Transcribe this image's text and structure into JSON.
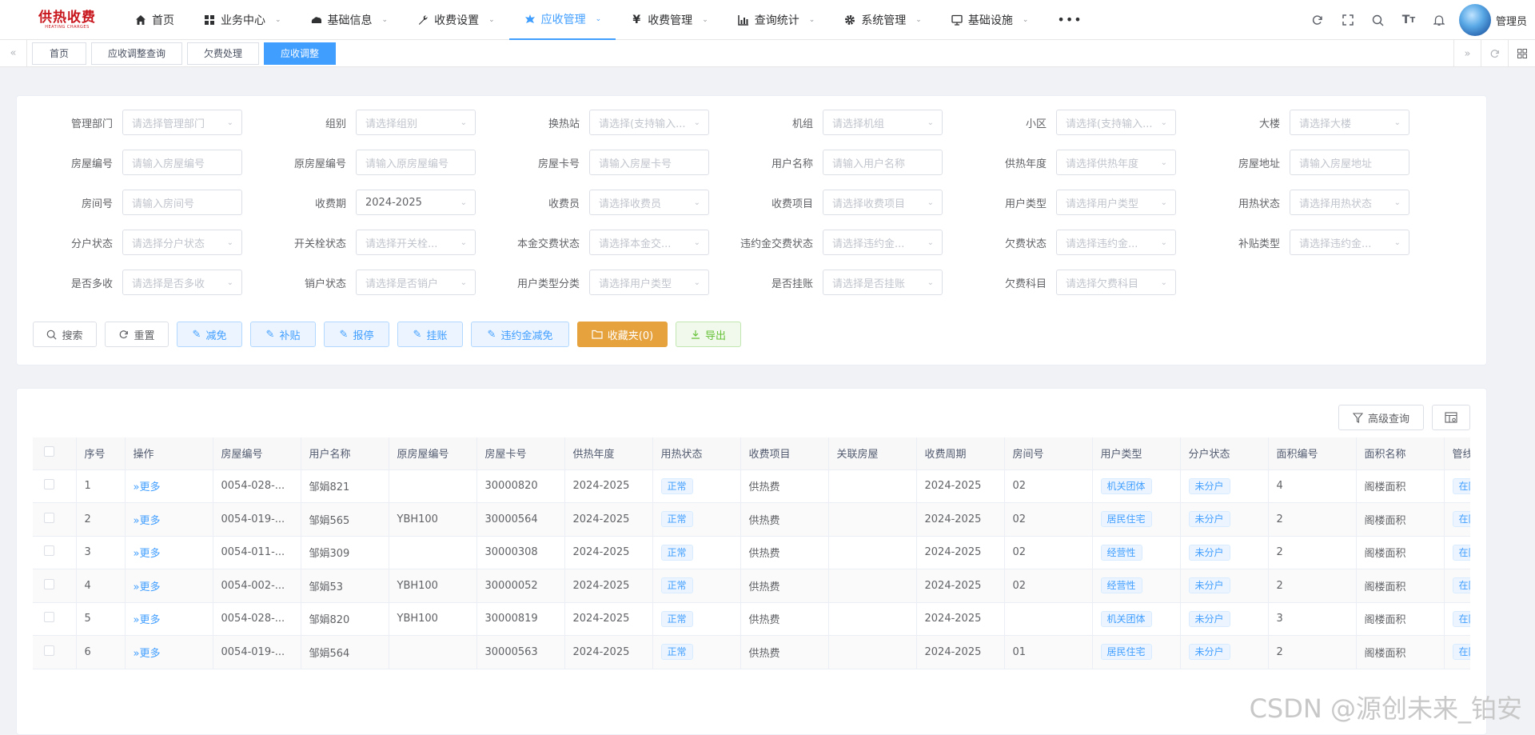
{
  "logo": {
    "main": "供热收费",
    "sub": "HEATING CHARGES"
  },
  "nav": [
    {
      "label": "首页",
      "icon": "home-icon",
      "chevron": false,
      "active": false
    },
    {
      "label": "业务中心",
      "icon": "grid-icon",
      "chevron": true,
      "active": false
    },
    {
      "label": "基础信息",
      "icon": "cloud-icon",
      "chevron": true,
      "active": false
    },
    {
      "label": "收费设置",
      "icon": "wrench-icon",
      "chevron": true,
      "active": false
    },
    {
      "label": "应收管理",
      "icon": "leaf-icon",
      "chevron": true,
      "active": true
    },
    {
      "label": "收费管理",
      "icon": "yen-icon",
      "chevron": true,
      "active": false
    },
    {
      "label": "查询统计",
      "icon": "chart-icon",
      "chevron": true,
      "active": false
    },
    {
      "label": "系统管理",
      "icon": "gear-icon",
      "chevron": true,
      "active": false
    },
    {
      "label": "基础设施",
      "icon": "monitor-icon",
      "chevron": true,
      "active": false
    }
  ],
  "user": {
    "name": "管理员"
  },
  "tabs": [
    {
      "label": "首页",
      "active": false
    },
    {
      "label": "应收调整查询",
      "active": false
    },
    {
      "label": "欠费处理",
      "active": false
    },
    {
      "label": "应收调整",
      "active": true
    }
  ],
  "form": {
    "row1": [
      {
        "label": "管理部门",
        "placeholder": "请选择管理部门"
      },
      {
        "label": "组别",
        "placeholder": "请选择组别"
      },
      {
        "label": "换热站",
        "placeholder": "请选择(支持输入..."
      },
      {
        "label": "机组",
        "placeholder": "请选择机组"
      },
      {
        "label": "小区",
        "placeholder": "请选择(支持输入..."
      },
      {
        "label": "大楼",
        "placeholder": "请选择大楼"
      }
    ],
    "row2": [
      {
        "label": "房屋编号",
        "placeholder": "请输入房屋编号"
      },
      {
        "label": "原房屋编号",
        "placeholder": "请输入原房屋编号"
      },
      {
        "label": "房屋卡号",
        "placeholder": "请输入房屋卡号"
      },
      {
        "label": "用户名称",
        "placeholder": "请输入用户名称"
      },
      {
        "label": "供热年度",
        "placeholder": "请选择供热年度"
      },
      {
        "label": "房屋地址",
        "placeholder": "请输入房屋地址"
      }
    ],
    "row3": [
      {
        "label": "房间号",
        "placeholder": "请输入房间号"
      },
      {
        "label": "收费期",
        "value": "2024-2025"
      },
      {
        "label": "收费员",
        "placeholder": "请选择收费员"
      },
      {
        "label": "收费项目",
        "placeholder": "请选择收费项目"
      },
      {
        "label": "用户类型",
        "placeholder": "请选择用户类型"
      },
      {
        "label": "用热状态",
        "placeholder": "请选择用热状态"
      }
    ],
    "row4": [
      {
        "label": "分户状态",
        "placeholder": "请选择分户状态"
      },
      {
        "label": "开关栓状态",
        "placeholder": "请选择开关栓..."
      },
      {
        "label": "本金交费状态",
        "placeholder": "请选择本金交..."
      },
      {
        "label": "违约金交费状态",
        "placeholder": "请选择违约金..."
      },
      {
        "label": "欠费状态",
        "placeholder": "请选择违约金..."
      },
      {
        "label": "补贴类型",
        "placeholder": "请选择违约金..."
      }
    ],
    "row5": [
      {
        "label": "是否多收",
        "placeholder": "请选择是否多收"
      },
      {
        "label": "销户状态",
        "placeholder": "请选择是否销户"
      },
      {
        "label": "用户类型分类",
        "placeholder": "请选择用户类型"
      },
      {
        "label": "是否挂账",
        "placeholder": "请选择是否挂账"
      },
      {
        "label": "欠费科目",
        "placeholder": "请选择欠费科目"
      }
    ]
  },
  "buttons": {
    "search": "搜索",
    "reset": "重置",
    "reduce": "减免",
    "subsidy": "补贴",
    "repair": "报停",
    "hang": "挂账",
    "penalty_reduce": "违约金减免",
    "favorites": "收藏夹(0)",
    "export": "导出"
  },
  "table_tools": {
    "advanced": "高级查询"
  },
  "table": {
    "headers": [
      "序号",
      "操作",
      "房屋编号",
      "用户名称",
      "原房屋编号",
      "房屋卡号",
      "供热年度",
      "用热状态",
      "收费项目",
      "关联房屋",
      "收费周期",
      "房间号",
      "用户类型",
      "分户状态",
      "面积编号",
      "面积名称",
      "管线状"
    ],
    "rows": [
      {
        "no": "1",
        "op": "更多",
        "house": "0054-028-...",
        "name": "邹娟821",
        "orig": "",
        "card": "30000820",
        "year": "2024-2025",
        "heat": "正常",
        "item": "供热费",
        "rel": "",
        "period": "2024-2025",
        "room": "02",
        "utype": "机关团体",
        "split": "未分户",
        "areano": "4",
        "areaname": "阁楼面积",
        "pipe": "在网"
      },
      {
        "no": "2",
        "op": "更多",
        "house": "0054-019-...",
        "name": "邹娟565",
        "orig": "YBH100",
        "card": "30000564",
        "year": "2024-2025",
        "heat": "正常",
        "item": "供热费",
        "rel": "",
        "period": "2024-2025",
        "room": "02",
        "utype": "居民住宅",
        "split": "未分户",
        "areano": "2",
        "areaname": "阁楼面积",
        "pipe": "在网"
      },
      {
        "no": "3",
        "op": "更多",
        "house": "0054-011-...",
        "name": "邹娟309",
        "orig": "",
        "card": "30000308",
        "year": "2024-2025",
        "heat": "正常",
        "item": "供热费",
        "rel": "",
        "period": "2024-2025",
        "room": "02",
        "utype": "经营性",
        "split": "未分户",
        "areano": "2",
        "areaname": "阁楼面积",
        "pipe": "在网"
      },
      {
        "no": "4",
        "op": "更多",
        "house": "0054-002-...",
        "name": "邹娟53",
        "orig": "YBH100",
        "card": "30000052",
        "year": "2024-2025",
        "heat": "正常",
        "item": "供热费",
        "rel": "",
        "period": "2024-2025",
        "room": "02",
        "utype": "经营性",
        "split": "未分户",
        "areano": "2",
        "areaname": "阁楼面积",
        "pipe": "在网"
      },
      {
        "no": "5",
        "op": "更多",
        "house": "0054-028-...",
        "name": "邹娟820",
        "orig": "YBH100",
        "card": "30000819",
        "year": "2024-2025",
        "heat": "正常",
        "item": "供热费",
        "rel": "",
        "period": "2024-2025",
        "room": "",
        "utype": "机关团体",
        "split": "未分户",
        "areano": "3",
        "areaname": "阁楼面积",
        "pipe": "在网"
      },
      {
        "no": "6",
        "op": "更多",
        "house": "0054-019-...",
        "name": "邹娟564",
        "orig": "",
        "card": "30000563",
        "year": "2024-2025",
        "heat": "正常",
        "item": "供热费",
        "rel": "",
        "period": "2024-2025",
        "room": "01",
        "utype": "居民住宅",
        "split": "未分户",
        "areano": "2",
        "areaname": "阁楼面积",
        "pipe": "在网"
      }
    ]
  },
  "watermark": "CSDN @源创未来_铂安",
  "colors": {
    "primary": "#409eff",
    "warning": "#e6a23c",
    "success": "#67c23a",
    "brand": "#c8161d"
  }
}
